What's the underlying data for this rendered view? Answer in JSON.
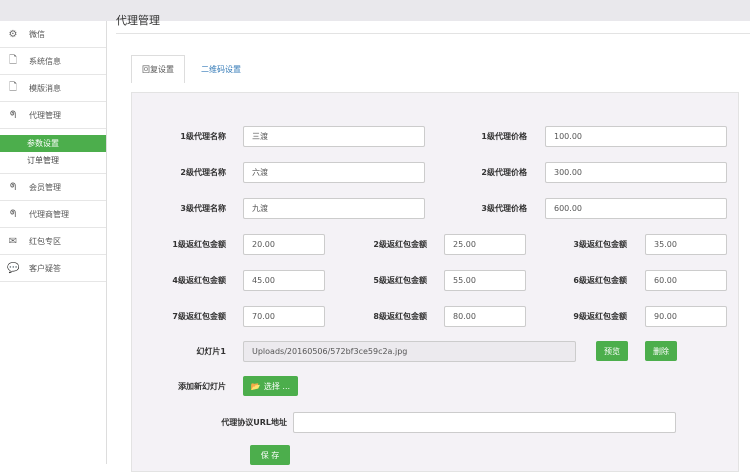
{
  "page_title": "代理管理",
  "sidebar": {
    "items": [
      {
        "label": "微信",
        "icon": "gears-icon"
      },
      {
        "label": "系统信息",
        "icon": "file-icon"
      },
      {
        "label": "模版消息",
        "icon": "file-icon"
      },
      {
        "label": "代理管理",
        "icon": "rss-icon"
      }
    ],
    "sub_items": [
      {
        "label": "参数设置",
        "active": true
      },
      {
        "label": "订单管理"
      }
    ],
    "items2": [
      {
        "label": "会员管理",
        "icon": "rss-icon"
      },
      {
        "label": "代理商管理",
        "icon": "rss-icon"
      },
      {
        "label": "红包专区",
        "icon": "envelope-icon"
      },
      {
        "label": "客户疑答",
        "icon": "comments-icon"
      }
    ]
  },
  "tabs": [
    {
      "label": "回复设置",
      "active": true
    },
    {
      "label": "二维码设置"
    }
  ],
  "form": {
    "agents": [
      {
        "name_label": "1级代理名称",
        "name": "三渡",
        "price_label": "1级代理价格",
        "price": "100.00"
      },
      {
        "name_label": "2级代理名称",
        "name": "六渡",
        "price_label": "2级代理价格",
        "price": "300.00"
      },
      {
        "name_label": "3级代理名称",
        "name": "九渡",
        "price_label": "3级代理价格",
        "price": "600.00"
      }
    ],
    "rebates": [
      {
        "label": "1级返红包金额",
        "value": "20.00"
      },
      {
        "label": "2级返红包金额",
        "value": "25.00"
      },
      {
        "label": "3级返红包金额",
        "value": "35.00"
      },
      {
        "label": "4级返红包金额",
        "value": "45.00"
      },
      {
        "label": "5级返红包金额",
        "value": "55.00"
      },
      {
        "label": "6级返红包金额",
        "value": "60.00"
      },
      {
        "label": "7级返红包金额",
        "value": "70.00"
      },
      {
        "label": "8级返红包金额",
        "value": "80.00"
      },
      {
        "label": "9级返红包金额",
        "value": "90.00"
      }
    ],
    "slide_label": "幻灯片1",
    "slide_value": "Uploads/20160506/572bf3ce59c2a.jpg",
    "preview": "预览",
    "delete": "删除",
    "add_slide_label": "添加新幻灯片",
    "choose": "选择 ...",
    "url_label": "代理协议URL地址",
    "url_value": "",
    "save": "保 存"
  },
  "accent": "#4cae4c"
}
